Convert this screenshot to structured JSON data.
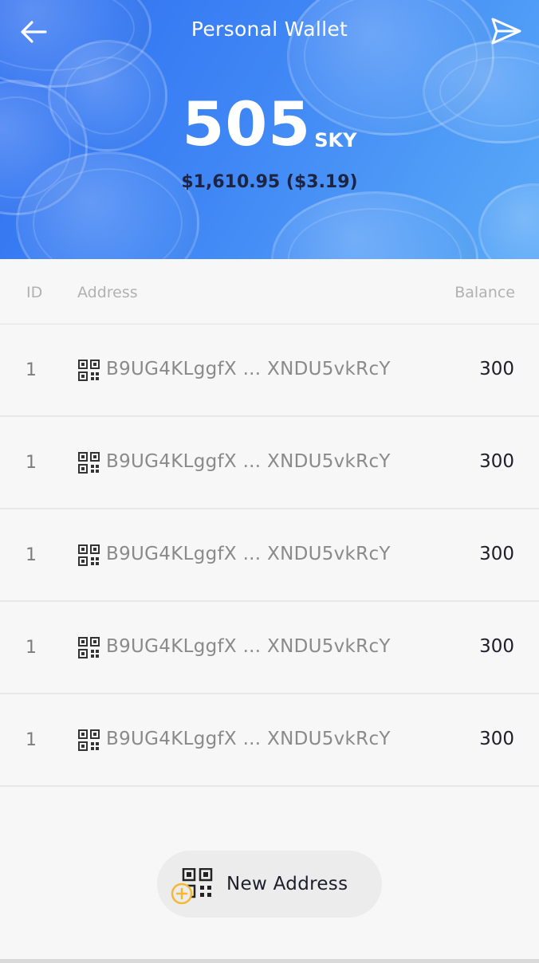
{
  "header": {
    "title": "Personal Wallet",
    "back_icon": "arrow-left-icon",
    "send_icon": "send-icon",
    "balance_value": "505",
    "balance_unit": "SKY",
    "fiat": "$1,610.95 ($3.19)",
    "gradient_colors": [
      "#2f6ff0",
      "#5aaaf8"
    ]
  },
  "table": {
    "headers": {
      "id": "ID",
      "address": "Address",
      "balance": "Balance"
    },
    "rows": [
      {
        "id": "1",
        "address": "B9UG4KLggfX ... XNDU5vkRcY",
        "balance": "300"
      },
      {
        "id": "1",
        "address": "B9UG4KLggfX ... XNDU5vkRcY",
        "balance": "300"
      },
      {
        "id": "1",
        "address": "B9UG4KLggfX ... XNDU5vkRcY",
        "balance": "300"
      },
      {
        "id": "1",
        "address": "B9UG4KLggfX ... XNDU5vkRcY",
        "balance": "300"
      },
      {
        "id": "1",
        "address": "B9UG4KLggfX ... XNDU5vkRcY",
        "balance": "300"
      }
    ]
  },
  "new_address": {
    "label": "New Address",
    "icon": "qr-add-icon",
    "accent_color": "#f5b82e"
  }
}
